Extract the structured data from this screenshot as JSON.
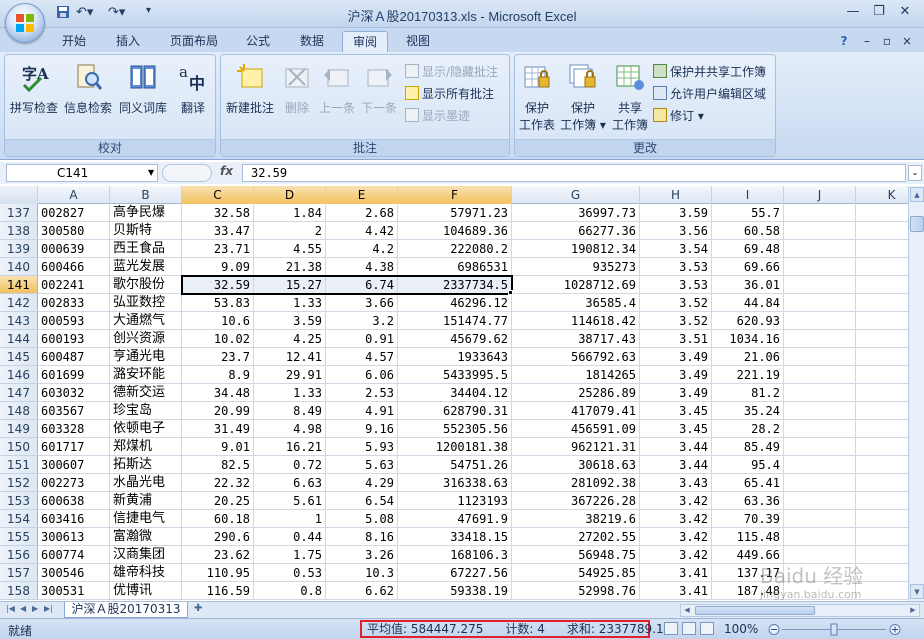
{
  "window": {
    "title": "沪深Ａ股20170313.xls - Microsoft Excel"
  },
  "tabs": [
    "开始",
    "插入",
    "页面布局",
    "公式",
    "数据",
    "审阅",
    "视图"
  ],
  "active_tab": "审阅",
  "ribbon": {
    "proofing": {
      "label": "校对",
      "spelling": "拼写检查",
      "research": "信息检索",
      "thesaurus": "同义词库",
      "translate": "翻译"
    },
    "comments": {
      "label": "批注",
      "new_comment": "新建批注",
      "delete": "删除",
      "previous": "上一条",
      "next": "下一条",
      "show_hide": "显示/隐藏批注",
      "show_all": "显示所有批注",
      "show_ink": "显示墨迹"
    },
    "changes": {
      "label": "更改",
      "protect_sheet_1": "保护",
      "protect_sheet_2": "工作表",
      "protect_workbook_1": "保护",
      "protect_workbook_2": "工作簿",
      "share_workbook_1": "共享",
      "share_workbook_2": "工作簿",
      "protect_share": "保护并共享工作簿",
      "allow_edit": "允许用户编辑区域",
      "track_changes": "修订"
    }
  },
  "formula_bar": {
    "name_box": "C141",
    "fx": "fx",
    "value": "32.59"
  },
  "columns": [
    "A",
    "B",
    "C",
    "D",
    "E",
    "F",
    "G",
    "H",
    "I",
    "J",
    "K"
  ],
  "rows": [
    {
      "n": "137",
      "a": "002827",
      "b": "高争民爆",
      "c": "32.58",
      "d": "1.84",
      "e": "2.68",
      "f": "57971.23",
      "g": "36997.73",
      "h": "3.59",
      "i": "55.7"
    },
    {
      "n": "138",
      "a": "300580",
      "b": "贝斯特",
      "c": "33.47",
      "d": "2",
      "e": "4.42",
      "f": "104689.36",
      "g": "66277.36",
      "h": "3.56",
      "i": "60.58"
    },
    {
      "n": "139",
      "a": "000639",
      "b": "西王食品",
      "c": "23.71",
      "d": "4.55",
      "e": "4.2",
      "f": "222080.2",
      "g": "190812.34",
      "h": "3.54",
      "i": "69.48"
    },
    {
      "n": "140",
      "a": "600466",
      "b": "蓝光发展",
      "c": "9.09",
      "d": "21.38",
      "e": "4.38",
      "f": "6986531",
      "g": "935273",
      "h": "3.53",
      "i": "69.66"
    },
    {
      "n": "141",
      "a": "002241",
      "b": "歌尔股份",
      "c": "32.59",
      "d": "15.27",
      "e": "6.74",
      "f": "2337734.5",
      "g": "1028712.69",
      "h": "3.53",
      "i": "36.01"
    },
    {
      "n": "142",
      "a": "002833",
      "b": "弘亚数控",
      "c": "53.83",
      "d": "1.33",
      "e": "3.66",
      "f": "46296.12",
      "g": "36585.4",
      "h": "3.52",
      "i": "44.84"
    },
    {
      "n": "143",
      "a": "000593",
      "b": "大通燃气",
      "c": "10.6",
      "d": "3.59",
      "e": "3.2",
      "f": "151474.77",
      "g": "114618.42",
      "h": "3.52",
      "i": "620.93"
    },
    {
      "n": "144",
      "a": "600193",
      "b": "创兴资源",
      "c": "10.02",
      "d": "4.25",
      "e": "0.91",
      "f": "45679.62",
      "g": "38717.43",
      "h": "3.51",
      "i": "1034.16"
    },
    {
      "n": "145",
      "a": "600487",
      "b": "亨通光电",
      "c": "23.7",
      "d": "12.41",
      "e": "4.57",
      "f": "1933643",
      "g": "566792.63",
      "h": "3.49",
      "i": "21.06"
    },
    {
      "n": "146",
      "a": "601699",
      "b": "潞安环能",
      "c": "8.9",
      "d": "29.91",
      "e": "6.06",
      "f": "5433995.5",
      "g": "1814265",
      "h": "3.49",
      "i": "221.19"
    },
    {
      "n": "147",
      "a": "603032",
      "b": "德新交运",
      "c": "34.48",
      "d": "1.33",
      "e": "2.53",
      "f": "34404.12",
      "g": "25286.89",
      "h": "3.49",
      "i": "81.2"
    },
    {
      "n": "148",
      "a": "603567",
      "b": "珍宝岛",
      "c": "20.99",
      "d": "8.49",
      "e": "4.91",
      "f": "628790.31",
      "g": "417079.41",
      "h": "3.45",
      "i": "35.24"
    },
    {
      "n": "149",
      "a": "603328",
      "b": "依顿电子",
      "c": "31.49",
      "d": "4.98",
      "e": "9.16",
      "f": "552305.56",
      "g": "456591.09",
      "h": "3.45",
      "i": "28.2"
    },
    {
      "n": "150",
      "a": "601717",
      "b": "郑煤机",
      "c": "9.01",
      "d": "16.21",
      "e": "5.93",
      "f": "1200181.38",
      "g": "962121.31",
      "h": "3.44",
      "i": "85.49"
    },
    {
      "n": "151",
      "a": "300607",
      "b": "拓斯达",
      "c": "82.5",
      "d": "0.72",
      "e": "5.63",
      "f": "54751.26",
      "g": "30618.63",
      "h": "3.44",
      "i": "95.4"
    },
    {
      "n": "152",
      "a": "002273",
      "b": "水晶光电",
      "c": "22.32",
      "d": "6.63",
      "e": "4.29",
      "f": "316338.63",
      "g": "281092.38",
      "h": "3.43",
      "i": "65.41"
    },
    {
      "n": "153",
      "a": "600638",
      "b": "新黄浦",
      "c": "20.25",
      "d": "5.61",
      "e": "6.54",
      "f": "1123193",
      "g": "367226.28",
      "h": "3.42",
      "i": "63.36"
    },
    {
      "n": "154",
      "a": "603416",
      "b": "信捷电气",
      "c": "60.18",
      "d": "1",
      "e": "5.08",
      "f": "47691.9",
      "g": "38219.6",
      "h": "3.42",
      "i": "70.39"
    },
    {
      "n": "155",
      "a": "300613",
      "b": "富瀚微",
      "c": "290.6",
      "d": "0.44",
      "e": "8.16",
      "f": "33418.15",
      "g": "27202.55",
      "h": "3.42",
      "i": "115.48"
    },
    {
      "n": "156",
      "a": "600774",
      "b": "汉商集团",
      "c": "23.62",
      "d": "1.75",
      "e": "3.26",
      "f": "168106.3",
      "g": "56948.75",
      "h": "3.42",
      "i": "449.66"
    },
    {
      "n": "157",
      "a": "300546",
      "b": "雄帝科技",
      "c": "110.95",
      "d": "0.53",
      "e": "10.3",
      "f": "67227.56",
      "g": "54925.85",
      "h": "3.41",
      "i": "137.17"
    },
    {
      "n": "158",
      "a": "300531",
      "b": "优博讯",
      "c": "116.59",
      "d": "0.8",
      "e": "6.62",
      "f": "59338.19",
      "g": "52998.76",
      "h": "3.41",
      "i": "187.48"
    }
  ],
  "sheet_tab": "沪深Ａ股20170313",
  "status": {
    "ready": "就绪",
    "average": "平均值: 584447.275",
    "count": "计数: 4",
    "sum": "求和: 2337789.1",
    "zoom": "100%"
  },
  "watermark": {
    "line1": "Baidu 经验",
    "line2": "jingyan.baidu.com"
  },
  "colors": {
    "accent": "#c7d9f0",
    "highlight": "#e0202b",
    "selection_header": "#f1c15f"
  }
}
